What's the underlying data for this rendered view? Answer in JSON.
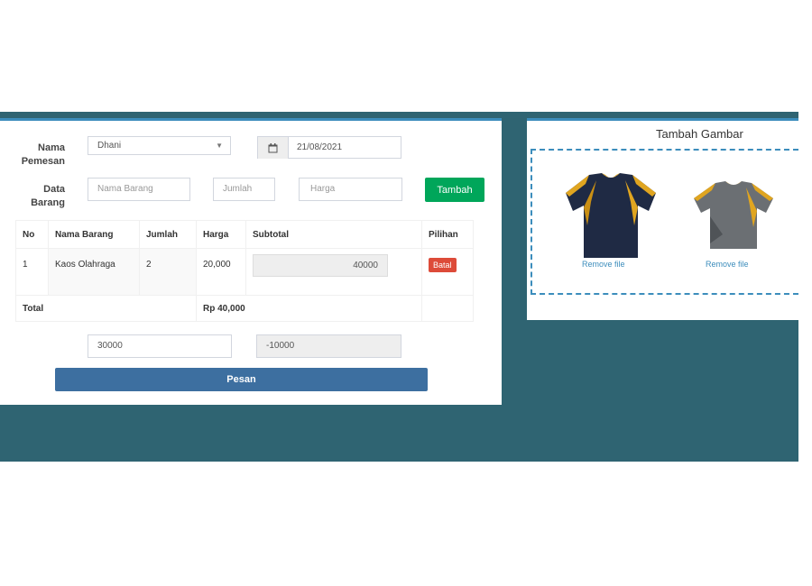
{
  "form": {
    "nama_pemesan_label": "Nama Pemesan",
    "customer_value": "Dhani",
    "date_value": "21/08/2021",
    "data_barang_label": "Data Barang",
    "nama_barang_placeholder": "Nama Barang",
    "jumlah_placeholder": "Jumlah",
    "harga_placeholder": "Harga",
    "tambah_label": "Tambah"
  },
  "table": {
    "headers": [
      "No",
      "Nama Barang",
      "Jumlah",
      "Harga",
      "Subtotal",
      "Pilihan"
    ],
    "rows": [
      {
        "no": "1",
        "nama": "Kaos Olahraga",
        "jumlah": "2",
        "harga": "20,000",
        "subtotal": "40000",
        "action": "Batal"
      }
    ],
    "total_label": "Total",
    "total_value": "Rp 40,000"
  },
  "payment": {
    "bayar_value": "30000",
    "kembali_value": "-10000",
    "pesan_label": "Pesan"
  },
  "upload": {
    "title": "Tambah Gambar",
    "files": [
      {
        "remove_label": "Remove file",
        "shirt_color": "#1f2a44",
        "accent_color": "#e0a520"
      },
      {
        "remove_label": "Remove file",
        "shirt_color": "#6b6f73",
        "accent_color": "#e0a520"
      }
    ]
  },
  "colors": {
    "background_band": "#2f6472",
    "accent": "#3c8dbc",
    "success": "#00a65a",
    "danger": "#dd4b39",
    "primary_button": "#3d6fa0"
  }
}
